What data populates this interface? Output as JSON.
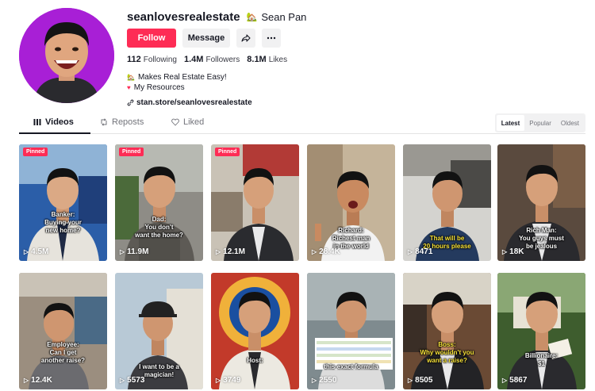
{
  "profile": {
    "username": "seanlovesrealestate",
    "nickname": "Sean Pan",
    "nickname_icon": "house-emoji",
    "follow_label": "Follow",
    "message_label": "Message",
    "share_icon": "share-arrow-icon",
    "more_icon": "more-dots-icon",
    "stats": {
      "following_count": "112",
      "following_label": "Following",
      "followers_count": "1.4M",
      "followers_label": "Followers",
      "likes_count": "8.1M",
      "likes_label": "Likes"
    },
    "bio_line1": "Makes Real Estate Easy!",
    "bio_line2": "My Resources",
    "link": "stan.store/seanlovesrealestate",
    "avatar_bg": "#a81fd6"
  },
  "tabs": {
    "videos": "Videos",
    "reposts": "Reposts",
    "liked": "Liked"
  },
  "sort": {
    "latest": "Latest",
    "popular": "Popular",
    "oldest": "Oldest"
  },
  "pinned_label": "Pinned",
  "videos": [
    {
      "views": "4.5M",
      "pinned": true,
      "caption": "Banker:\nBuying your\nnew home?",
      "yellow": false
    },
    {
      "views": "11.9M",
      "pinned": true,
      "caption": "Dad:\nYou don't\nwant the home?",
      "yellow": false
    },
    {
      "views": "12.1M",
      "pinned": true,
      "caption": "",
      "yellow": true
    },
    {
      "views": "28.4K",
      "pinned": false,
      "caption": "Richard:\nRichest man\nin the world",
      "yellow": false
    },
    {
      "views": "8471",
      "pinned": false,
      "caption": "That will be\n20 hours please",
      "yellow": true
    },
    {
      "views": "18K",
      "pinned": false,
      "caption": "Rich Man:\nYou guys must\nbe jealous",
      "yellow": false
    },
    {
      "views": "12.4K",
      "pinned": false,
      "caption": "Employee:\nCan I get\nanother raise?",
      "yellow": false
    },
    {
      "views": "5573",
      "pinned": false,
      "caption": "I want to be a\nmagician!",
      "yellow": false
    },
    {
      "views": "3749",
      "pinned": false,
      "caption": "Host:",
      "yellow": false
    },
    {
      "views": "2550",
      "pinned": false,
      "caption": "this exact formula",
      "yellow": false
    },
    {
      "views": "8505",
      "pinned": false,
      "caption": "Boss:\nWhy wouldn't you\nwant a raise?",
      "yellow": false
    },
    {
      "views": "5867",
      "pinned": false,
      "caption": "Billionaire:\n$1",
      "yellow": false
    }
  ]
}
